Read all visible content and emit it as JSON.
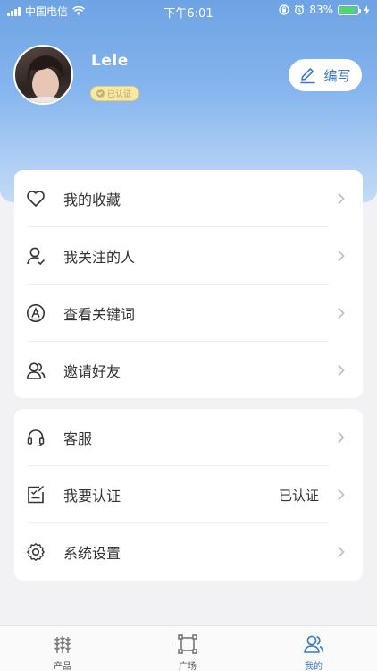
{
  "status_bar": {
    "carrier": "中国电信",
    "time": "下午6:01",
    "battery_percent": "83%",
    "battery_level": 0.83
  },
  "profile": {
    "username": "Lele",
    "badge": "已认证",
    "edit_label": "编写"
  },
  "menu_group_1": [
    {
      "label": "我的收藏",
      "icon": "heart-icon"
    },
    {
      "label": "我关注的人",
      "icon": "user-check-icon"
    },
    {
      "label": "查看关键词",
      "icon": "letter-a-circle-icon"
    },
    {
      "label": "邀请好友",
      "icon": "users-icon"
    }
  ],
  "menu_group_2": [
    {
      "label": "客服",
      "icon": "headset-icon"
    },
    {
      "label": "我要认证",
      "icon": "certify-icon",
      "value": "已认证"
    },
    {
      "label": "系统设置",
      "icon": "gear-icon"
    }
  ],
  "tabbar": [
    {
      "label": "产品",
      "icon": "wheat-icon",
      "active": false
    },
    {
      "label": "广场",
      "icon": "square-icon",
      "active": false
    },
    {
      "label": "我的",
      "icon": "profile-icon",
      "active": true
    }
  ],
  "colors": {
    "accent": "#3c78c8",
    "header_top": "#6ea3e4",
    "header_bottom": "#c2dbf7",
    "background": "#f2f2f4",
    "badge_bg": "#f7e8a6"
  }
}
